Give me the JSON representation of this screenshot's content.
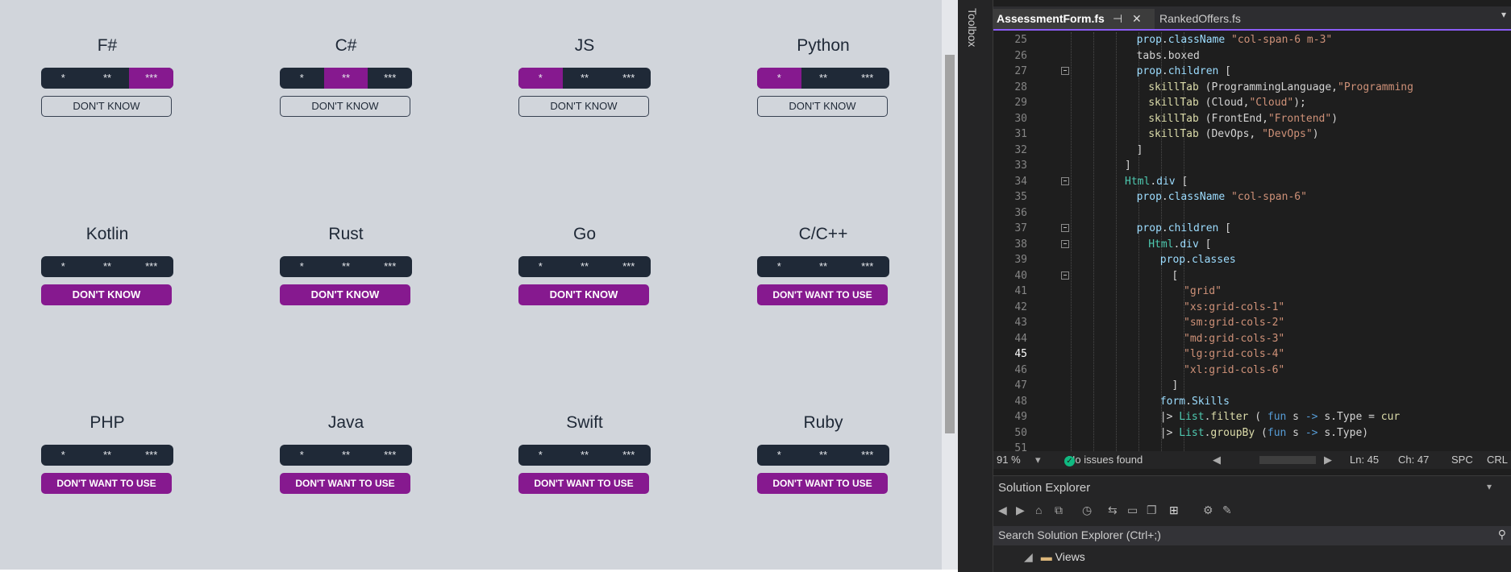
{
  "skills": [
    {
      "name": "F#",
      "level": 3,
      "button": "DON'T KNOW",
      "selected": false
    },
    {
      "name": "C#",
      "level": 2,
      "button": "DON'T KNOW",
      "selected": false
    },
    {
      "name": "JS",
      "level": 1,
      "button": "DON'T KNOW",
      "selected": false
    },
    {
      "name": "Python",
      "level": 1,
      "button": "DON'T KNOW",
      "selected": false
    },
    {
      "name": "Kotlin",
      "level": 0,
      "button": "DON'T KNOW",
      "selected": true
    },
    {
      "name": "Rust",
      "level": 0,
      "button": "DON'T KNOW",
      "selected": true
    },
    {
      "name": "Go",
      "level": 0,
      "button": "DON'T KNOW",
      "selected": true
    },
    {
      "name": "C/C++",
      "level": 0,
      "button": "DON'T WANT TO USE",
      "selected": true
    },
    {
      "name": "PHP",
      "level": 0,
      "button": "DON'T WANT TO USE",
      "selected": true
    },
    {
      "name": "Java",
      "level": 0,
      "button": "DON'T WANT TO USE",
      "selected": true
    },
    {
      "name": "Swift",
      "level": 0,
      "button": "DON'T WANT TO USE",
      "selected": true
    },
    {
      "name": "Ruby",
      "level": 0,
      "button": "DON'T WANT TO USE",
      "selected": true
    }
  ],
  "rating_labels": [
    "*",
    "**",
    "***"
  ],
  "colors": {
    "accent": "#86198f",
    "rating_bg": "#1f2937",
    "page_bg": "#d1d5db"
  },
  "ide": {
    "toolbox": "Toolbox",
    "tabs": [
      {
        "label": "AssessmentForm.fs",
        "active": true,
        "pin": "⊣",
        "close": "✕"
      },
      {
        "label": "RankedOffers.fs",
        "active": false
      }
    ],
    "current_line": 45,
    "code": [
      {
        "n": 25,
        "indent": 6,
        "tokens": [
          [
            "prop",
            "prop"
          ],
          [
            "plain",
            "."
          ],
          [
            "prop",
            "className "
          ],
          [
            "str",
            "\"col-span-6 m-3\""
          ]
        ]
      },
      {
        "n": 26,
        "indent": 6,
        "tokens": [
          [
            "plain",
            "tabs.boxed"
          ]
        ]
      },
      {
        "n": 27,
        "indent": 6,
        "fold": true,
        "tokens": [
          [
            "prop",
            "prop"
          ],
          [
            "plain",
            "."
          ],
          [
            "prop",
            "children"
          ],
          [
            "plain",
            " ["
          ]
        ]
      },
      {
        "n": 28,
        "indent": 7,
        "tokens": [
          [
            "fn",
            "skillTab"
          ],
          [
            "plain",
            " ("
          ],
          [
            "plain",
            "ProgrammingLanguage,"
          ],
          [
            "str",
            "\"Programming"
          ]
        ]
      },
      {
        "n": 29,
        "indent": 7,
        "tokens": [
          [
            "fn",
            "skillTab"
          ],
          [
            "plain",
            " (Cloud,"
          ],
          [
            "str",
            "\"Cloud\""
          ],
          [
            "plain",
            ");"
          ]
        ]
      },
      {
        "n": 30,
        "indent": 7,
        "tokens": [
          [
            "fn",
            "skillTab"
          ],
          [
            "plain",
            " (FrontEnd,"
          ],
          [
            "str",
            "\"Frontend\""
          ],
          [
            "plain",
            ")"
          ]
        ]
      },
      {
        "n": 31,
        "indent": 7,
        "tokens": [
          [
            "fn",
            "skillTab"
          ],
          [
            "plain",
            " (DevOps, "
          ],
          [
            "str",
            "\"DevOps\""
          ],
          [
            "plain",
            ")"
          ]
        ]
      },
      {
        "n": 32,
        "indent": 6,
        "tokens": [
          [
            "plain",
            "]"
          ]
        ]
      },
      {
        "n": 33,
        "indent": 5,
        "tokens": [
          [
            "plain",
            "]"
          ]
        ]
      },
      {
        "n": 34,
        "indent": 5,
        "fold": true,
        "tokens": [
          [
            "type",
            "Html"
          ],
          [
            "plain",
            "."
          ],
          [
            "prop",
            "div"
          ],
          [
            "plain",
            " ["
          ]
        ]
      },
      {
        "n": 35,
        "indent": 6,
        "tokens": [
          [
            "prop",
            "prop"
          ],
          [
            "plain",
            "."
          ],
          [
            "prop",
            "className "
          ],
          [
            "str",
            "\"col-span-6\""
          ]
        ]
      },
      {
        "n": 36,
        "indent": 0,
        "tokens": []
      },
      {
        "n": 37,
        "indent": 6,
        "fold": true,
        "tokens": [
          [
            "prop",
            "prop"
          ],
          [
            "plain",
            "."
          ],
          [
            "prop",
            "children"
          ],
          [
            "plain",
            " ["
          ]
        ]
      },
      {
        "n": 38,
        "indent": 7,
        "fold": true,
        "tokens": [
          [
            "type",
            "Html"
          ],
          [
            "plain",
            "."
          ],
          [
            "prop",
            "div"
          ],
          [
            "plain",
            " ["
          ]
        ]
      },
      {
        "n": 39,
        "indent": 8,
        "tokens": [
          [
            "prop",
            "prop"
          ],
          [
            "plain",
            "."
          ],
          [
            "prop",
            "classes"
          ]
        ]
      },
      {
        "n": 40,
        "indent": 9,
        "fold": true,
        "tokens": [
          [
            "plain",
            "["
          ]
        ]
      },
      {
        "n": 41,
        "indent": 10,
        "tokens": [
          [
            "str",
            "\"grid\""
          ]
        ]
      },
      {
        "n": 42,
        "indent": 10,
        "tokens": [
          [
            "str",
            "\"xs:grid-cols-1\""
          ]
        ]
      },
      {
        "n": 43,
        "indent": 10,
        "tokens": [
          [
            "str",
            "\"sm:grid-cols-2\""
          ]
        ]
      },
      {
        "n": 44,
        "indent": 10,
        "tokens": [
          [
            "str",
            "\"md:grid-cols-3\""
          ]
        ]
      },
      {
        "n": 45,
        "indent": 10,
        "tokens": [
          [
            "str",
            "\"lg:grid-cols-4\""
          ]
        ]
      },
      {
        "n": 46,
        "indent": 10,
        "tokens": [
          [
            "str",
            "\"xl:grid-cols-6\""
          ]
        ]
      },
      {
        "n": 47,
        "indent": 9,
        "tokens": [
          [
            "plain",
            "]"
          ]
        ]
      },
      {
        "n": 48,
        "indent": 8,
        "tokens": [
          [
            "prop",
            "form"
          ],
          [
            "plain",
            "."
          ],
          [
            "prop",
            "Skills"
          ]
        ]
      },
      {
        "n": 49,
        "indent": 8,
        "tokens": [
          [
            "plain",
            "|> "
          ],
          [
            "type",
            "List"
          ],
          [
            "plain",
            "."
          ],
          [
            "fn",
            "filter"
          ],
          [
            "plain",
            " ( "
          ],
          [
            "kw",
            "fun"
          ],
          [
            "plain",
            " s "
          ],
          [
            "kw",
            "->"
          ],
          [
            "plain",
            " s.Type = "
          ],
          [
            "fn",
            "cur"
          ]
        ]
      },
      {
        "n": 50,
        "indent": 8,
        "tokens": [
          [
            "plain",
            "|> "
          ],
          [
            "type",
            "List"
          ],
          [
            "plain",
            "."
          ],
          [
            "fn",
            "groupBy"
          ],
          [
            "plain",
            " ("
          ],
          [
            "kw",
            "fun"
          ],
          [
            "plain",
            " s "
          ],
          [
            "kw",
            "->"
          ],
          [
            "plain",
            " s.Type)"
          ]
        ]
      },
      {
        "n": 51,
        "indent": 0,
        "tokens": []
      }
    ],
    "status": {
      "zoom": "91 %",
      "issues": "No issues found",
      "ln": "Ln: 45",
      "ch": "Ch: 47",
      "enc": "SPC",
      "eol": "CRL"
    },
    "solution_explorer": {
      "title": "Solution Explorer",
      "search_placeholder": "Search Solution Explorer (Ctrl+;)",
      "tree": [
        {
          "label": "Views"
        }
      ]
    }
  }
}
